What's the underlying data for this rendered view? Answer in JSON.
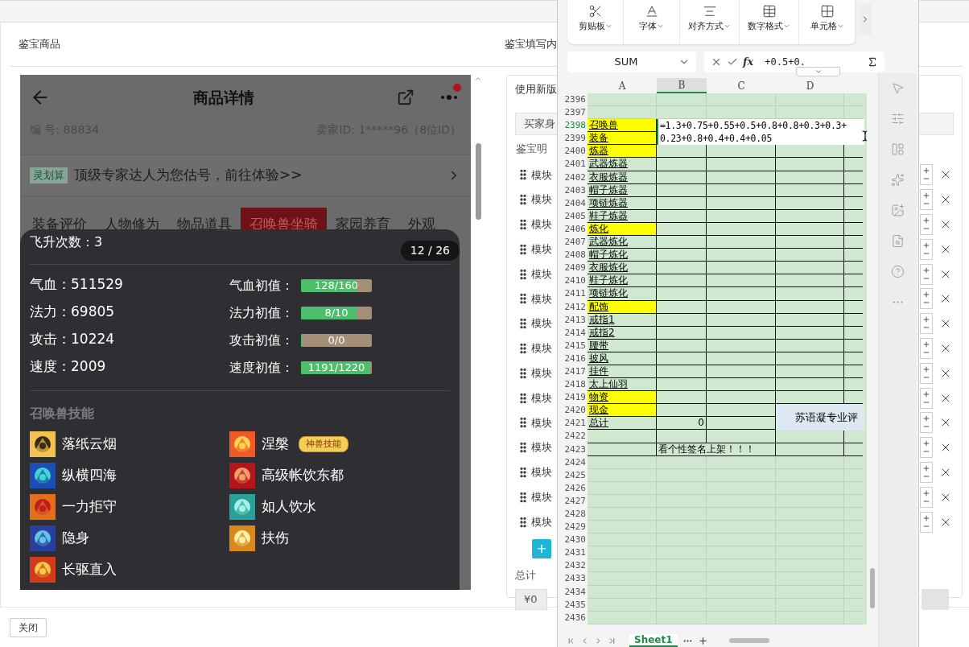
{
  "left_panel": {
    "title": "鉴宝商品",
    "product": {
      "title": "商品详情",
      "has_notification": true,
      "serial": "编 号: 88834",
      "seller": "卖家ID: 1*****96（8位ID）",
      "promo_tag": "灵划算",
      "promo_text": "顶级专家达人为您估号，前往体验>>",
      "tabs": [
        {
          "label": "装备评价",
          "selected": false
        },
        {
          "label": "人物修为",
          "selected": false
        },
        {
          "label": "物品道具",
          "selected": false
        },
        {
          "label": "召唤兽坐骑",
          "selected": true
        },
        {
          "label": "家园养育",
          "selected": false
        },
        {
          "label": "外观",
          "selected": false
        }
      ]
    },
    "popup": {
      "ascension": "飞升次数：3",
      "pager": "12 / 26",
      "stats": [
        {
          "label": "气血：",
          "value": "511529"
        },
        {
          "label": "法力：",
          "value": "69805"
        },
        {
          "label": "攻击：",
          "value": "10224"
        },
        {
          "label": "速度：",
          "value": "2009"
        }
      ],
      "initials": [
        {
          "label": "气血初值：",
          "reading": "128/160",
          "level": 0.8
        },
        {
          "label": "法力初值：",
          "reading": "8/10",
          "level": 0.8
        },
        {
          "label": "攻击初值：",
          "reading": "0/0",
          "level": 0
        },
        {
          "label": "速度初值：",
          "reading": "1191/1220",
          "level": 0.976
        }
      ],
      "skills_title": "召唤兽技能",
      "skills": [
        {
          "name": "落纸云烟"
        },
        {
          "name": "涅槃",
          "badge": "神兽技能"
        },
        {
          "name": "纵横四海"
        },
        {
          "name": "高级帐饮东都"
        },
        {
          "name": "一力拒守"
        },
        {
          "name": "如人饮水"
        },
        {
          "name": "隐身"
        },
        {
          "name": "扶伤"
        },
        {
          "name": "长驱直入"
        }
      ]
    }
  },
  "right_panel": {
    "title": "鉴宝填写内",
    "version": "使用新版",
    "buyer": "买家身",
    "detail": "鉴宝明",
    "module_count_rows": [
      {
        "label": "模块"
      },
      {
        "label": "模块"
      },
      {
        "label": "模块"
      },
      {
        "label": "模块"
      },
      {
        "label": "模块"
      },
      {
        "label": "模块"
      },
      {
        "label": "模块"
      },
      {
        "label": "模块"
      },
      {
        "label": "模块"
      },
      {
        "label": "模块"
      },
      {
        "label": "模块"
      },
      {
        "label": "模块"
      },
      {
        "label": "模块"
      },
      {
        "label": "模块"
      },
      {
        "label": "模块"
      }
    ],
    "add": "+",
    "total_label": "总计",
    "total_value": "¥0"
  },
  "footer": {
    "close": "关闭"
  },
  "spreadsheet": {
    "ribbon": [
      "剪贴板",
      "字体",
      "对齐方式",
      "数字格式",
      "单元格"
    ],
    "name_box": "SUM",
    "fx": "fx",
    "formula": "+0.5+0.",
    "columns": [
      {
        "label": "A",
        "selected": false
      },
      {
        "label": "B",
        "selected": true
      },
      {
        "label": "C",
        "selected": false
      },
      {
        "label": "D",
        "selected": false
      }
    ],
    "rows": [
      {
        "num": "2396",
        "kind": "blank",
        "selected": false
      },
      {
        "num": "2397",
        "kind": "blank",
        "selected": false
      },
      {
        "num": "2398",
        "kind": "section",
        "a": "召唤兽",
        "selected": true
      },
      {
        "num": "2399",
        "kind": "section",
        "a": "装备",
        "selected": false
      },
      {
        "num": "2400",
        "kind": "section",
        "a": "炼器",
        "selected": false
      },
      {
        "num": "2401",
        "kind": "item",
        "a": "武器炼器",
        "selected": false
      },
      {
        "num": "2402",
        "kind": "item",
        "a": "衣服炼器",
        "selected": false
      },
      {
        "num": "2403",
        "kind": "item",
        "a": "帽子炼器",
        "selected": false
      },
      {
        "num": "2404",
        "kind": "item",
        "a": "项链炼器",
        "selected": false
      },
      {
        "num": "2405",
        "kind": "item",
        "a": "鞋子炼器",
        "selected": false
      },
      {
        "num": "2406",
        "kind": "section",
        "a": "炼化",
        "selected": false
      },
      {
        "num": "2407",
        "kind": "item",
        "a": "武器炼化",
        "selected": false
      },
      {
        "num": "2408",
        "kind": "item",
        "a": "帽子炼化",
        "selected": false
      },
      {
        "num": "2409",
        "kind": "item",
        "a": "衣服炼化",
        "selected": false
      },
      {
        "num": "2410",
        "kind": "item",
        "a": "鞋子炼化",
        "selected": false
      },
      {
        "num": "2411",
        "kind": "item",
        "a": "项链炼化",
        "selected": false
      },
      {
        "num": "2412",
        "kind": "section",
        "a": "配饰",
        "selected": false
      },
      {
        "num": "2413",
        "kind": "item",
        "a": "戒指1",
        "selected": false
      },
      {
        "num": "2414",
        "kind": "item",
        "a": "戒指2",
        "selected": false
      },
      {
        "num": "2415",
        "kind": "item",
        "a": "腰带",
        "selected": false
      },
      {
        "num": "2416",
        "kind": "item",
        "a": "披风",
        "selected": false
      },
      {
        "num": "2417",
        "kind": "item",
        "a": "挂件",
        "selected": false
      },
      {
        "num": "2418",
        "kind": "item",
        "a": "太上仙羽",
        "selected": false
      },
      {
        "num": "2419",
        "kind": "section",
        "a": "物资",
        "selected": false
      },
      {
        "num": "2420",
        "kind": "section",
        "a": "现金",
        "selected": false
      },
      {
        "num": "2421",
        "kind": "item",
        "a": "总计",
        "b": "0",
        "selected": false
      },
      {
        "num": "2422",
        "kind": "item",
        "selected": false
      },
      {
        "num": "2423",
        "kind": "item",
        "b": "看个性签名上架！！！",
        "selected": false
      },
      {
        "num": "2424",
        "kind": "blank",
        "selected": false
      },
      {
        "num": "2425",
        "kind": "blank",
        "selected": false
      },
      {
        "num": "2426",
        "kind": "blank",
        "selected": false
      },
      {
        "num": "2427",
        "kind": "blank",
        "selected": false
      },
      {
        "num": "2428",
        "kind": "blank",
        "selected": false
      },
      {
        "num": "2429",
        "kind": "blank",
        "selected": false
      },
      {
        "num": "2430",
        "kind": "blank",
        "selected": false
      },
      {
        "num": "2431",
        "kind": "blank",
        "selected": false
      },
      {
        "num": "2432",
        "kind": "blank",
        "selected": false
      },
      {
        "num": "2433",
        "kind": "blank",
        "selected": false
      },
      {
        "num": "2434",
        "kind": "blank",
        "selected": false
      },
      {
        "num": "2435",
        "kind": "blank",
        "selected": false
      },
      {
        "num": "2436",
        "kind": "blank",
        "selected": false
      }
    ],
    "editor_lines": [
      "=1.3+0.75+0.55+0.5+0.8+0.8+0.3+0.3+",
      "0.23+0.8+0.4+0.4+0.05"
    ],
    "merged_note": "苏语凝专业评",
    "sheet_tab": "Sheet1"
  }
}
